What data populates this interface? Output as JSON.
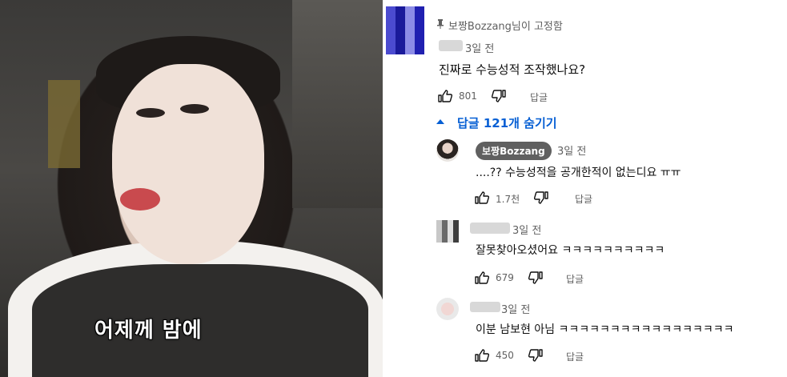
{
  "video": {
    "subtitle": "어제께 밤에"
  },
  "pinned": {
    "pin_label": "보짱Bozzang님이 고정함",
    "time": "3일 전",
    "text": "진짜로 수능성적 조작했나요?",
    "likes": "801",
    "reply_label": "답글"
  },
  "replies_toggle": {
    "label": "답글 121개 숨기기"
  },
  "replies": [
    {
      "author": "보짱Bozzang",
      "time": "3일 전",
      "text": "....?? 수능성적을 공개한적이 없는디요 ㅠㅠ",
      "likes": "1.7천",
      "reply_label": "답글"
    },
    {
      "time": "3일 전",
      "text": "잘못찾아오셨어요 ㅋㅋㅋㅋㅋㅋㅋㅋㅋㅋ",
      "likes": "679",
      "reply_label": "답글"
    },
    {
      "time": "3일 전",
      "text": "이분 남보현 아님 ㅋㅋㅋㅋㅋㅋㅋㅋㅋㅋㅋㅋㅋㅋㅋㅋㅋ",
      "likes": "450",
      "reply_label": "답글"
    }
  ],
  "colors": {
    "link": "#065fd4",
    "meta": "#606060"
  }
}
